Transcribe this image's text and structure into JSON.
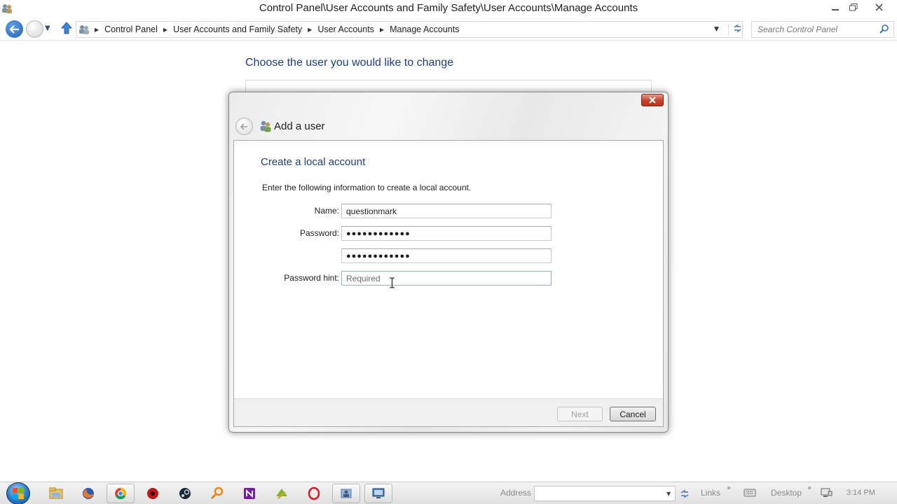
{
  "window": {
    "title": "Control Panel\\User Accounts and Family Safety\\User Accounts\\Manage Accounts",
    "app_icon": "user-accounts-icon"
  },
  "navigation": {
    "breadcrumbs": [
      "Control Panel",
      "User Accounts and Family Safety",
      "User Accounts",
      "Manage Accounts"
    ],
    "search_placeholder": "Search Control Panel"
  },
  "page": {
    "heading": "Choose the user you would like to change"
  },
  "dialog": {
    "title": "Add a user",
    "subtitle": "Create a local account",
    "instruction": "Enter the following information to create a local account.",
    "fields": {
      "name_label": "Name:",
      "name_value": "questionmark",
      "password_label": "Password:",
      "password_value": "●●●●●●●●●●●●",
      "confirm_value": "●●●●●●●●●●●●",
      "hint_label": "Password hint:",
      "hint_placeholder": "Required"
    },
    "buttons": {
      "next": "Next",
      "cancel": "Cancel"
    }
  },
  "taskbar": {
    "address_label": "Address",
    "links_label": "Links",
    "desktop_label": "Desktop",
    "clock": "3:14 PM",
    "pinned": [
      "file-explorer-icon",
      "firefox-icon",
      "chrome-icon",
      "red-record-icon",
      "steam-icon",
      "magnifier-icon",
      "onenote-icon",
      "green-app-icon",
      "opera-icon",
      "user-accounts-icon",
      "remote-desktop-icon"
    ]
  },
  "colors": {
    "heading_blue": "#1e3d84",
    "close_red": "#c4442c",
    "accent_blue": "#2a6fc9"
  }
}
